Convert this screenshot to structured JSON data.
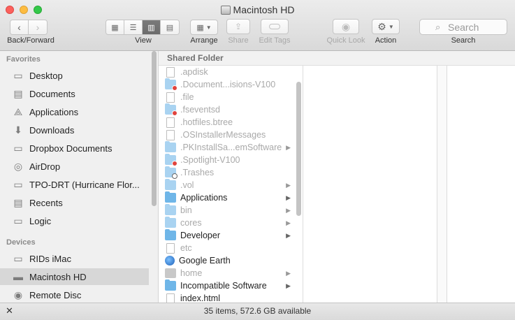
{
  "window": {
    "title": "Macintosh HD"
  },
  "toolbar": {
    "back_forward_label": "Back/Forward",
    "view_label": "View",
    "arrange_label": "Arrange",
    "share_label": "Share",
    "edit_tags_label": "Edit Tags",
    "quick_look_label": "Quick Look",
    "action_label": "Action",
    "search_label": "Search",
    "search_placeholder": "Search"
  },
  "sidebar": {
    "favorites_heading": "Favorites",
    "devices_heading": "Devices",
    "favorites": [
      {
        "label": "Desktop",
        "icon": "desktop-icon"
      },
      {
        "label": "Documents",
        "icon": "documents-icon"
      },
      {
        "label": "Applications",
        "icon": "applications-icon"
      },
      {
        "label": "Downloads",
        "icon": "downloads-icon"
      },
      {
        "label": "Dropbox Documents",
        "icon": "folder-icon"
      },
      {
        "label": "AirDrop",
        "icon": "airdrop-icon"
      },
      {
        "label": "TPO-DRT (Hurricane Flor...",
        "icon": "folder-icon"
      },
      {
        "label": "Recents",
        "icon": "recents-icon"
      },
      {
        "label": "Logic",
        "icon": "folder-icon"
      }
    ],
    "devices": [
      {
        "label": "RIDs iMac",
        "icon": "imac-icon"
      },
      {
        "label": "Macintosh HD",
        "icon": "hard-drive-icon",
        "selected": true
      },
      {
        "label": "Remote Disc",
        "icon": "disc-icon"
      }
    ]
  },
  "column": {
    "header": "Shared Folder",
    "items": [
      {
        "name": ".apdisk",
        "kind": "file",
        "dim": true
      },
      {
        "name": ".Document...isions-V100",
        "kind": "folder-restricted",
        "dim": true
      },
      {
        "name": ".file",
        "kind": "file",
        "dim": true
      },
      {
        "name": ".fseventsd",
        "kind": "folder-restricted",
        "dim": true
      },
      {
        "name": ".hotfiles.btree",
        "kind": "file",
        "dim": true
      },
      {
        "name": ".OSInstallerMessages",
        "kind": "file",
        "dim": true
      },
      {
        "name": ".PKInstallSa...emSoftware",
        "kind": "folder",
        "dim": true,
        "arrow": true
      },
      {
        "name": ".Spotlight-V100",
        "kind": "folder-restricted",
        "dim": true
      },
      {
        "name": ".Trashes",
        "kind": "folder-plus",
        "dim": true
      },
      {
        "name": ".vol",
        "kind": "folder",
        "dim": true,
        "arrow": true
      },
      {
        "name": "Applications",
        "kind": "folder",
        "dim": false,
        "arrow": true
      },
      {
        "name": "bin",
        "kind": "folder",
        "dim": true,
        "arrow": true
      },
      {
        "name": "cores",
        "kind": "folder",
        "dim": true,
        "arrow": true
      },
      {
        "name": "Developer",
        "kind": "folder",
        "dim": false,
        "arrow": true
      },
      {
        "name": "etc",
        "kind": "alias",
        "dim": true
      },
      {
        "name": "Google Earth",
        "kind": "app",
        "dim": false
      },
      {
        "name": "home",
        "kind": "server",
        "dim": true,
        "arrow": true
      },
      {
        "name": "Incompatible Software",
        "kind": "folder",
        "dim": false,
        "arrow": true
      },
      {
        "name": "index.html",
        "kind": "file",
        "dim": false
      }
    ]
  },
  "status_bar": {
    "text": "35 items, 572.6 GB available"
  },
  "colors": {
    "folder_blue": "#6fb6e8",
    "selection_gray": "#d7d7d7",
    "close_red": "#fc605c",
    "minimize_yellow": "#fdbc40",
    "zoom_green": "#34c84a"
  }
}
